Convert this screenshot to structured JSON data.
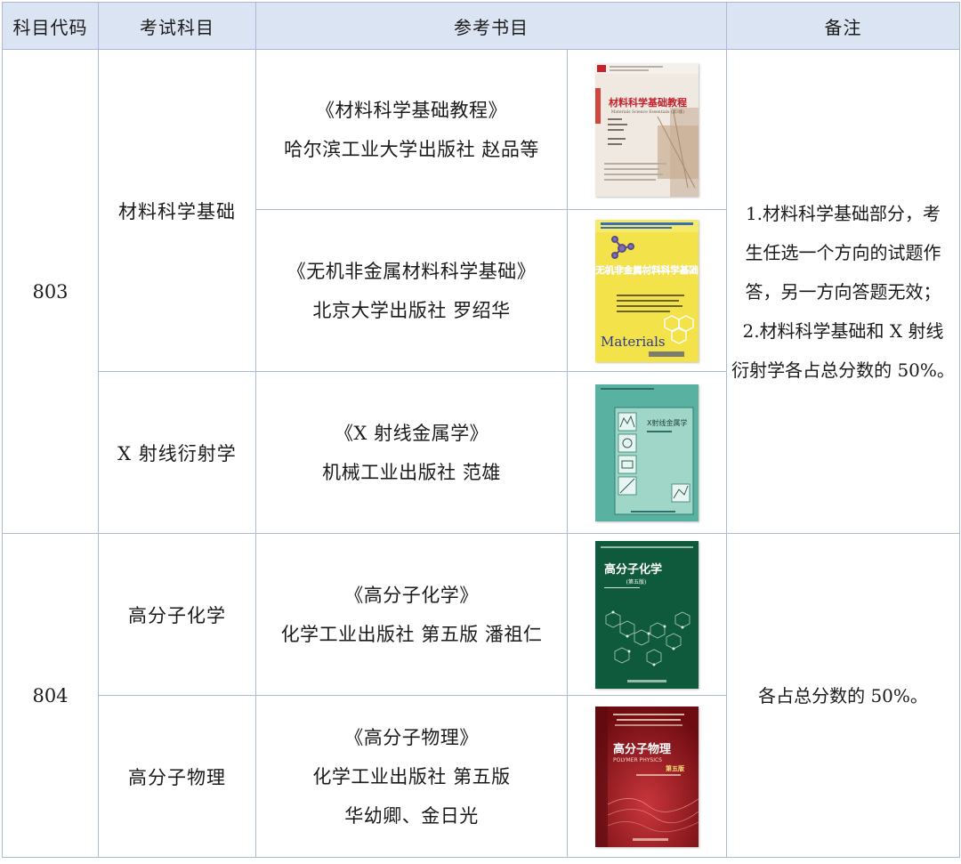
{
  "headers": {
    "code": "科目代码",
    "subject": "考试科目",
    "books": "参考书目",
    "notes": "备注"
  },
  "groups": [
    {
      "code": "803",
      "note_lines": [
        "1.材料科学基础部分，考",
        "生任选一个方向的试题作",
        "答，另一方向答题无效；",
        "2.材料科学基础和 X 射线",
        "衍射学各占总分数的 50%。"
      ],
      "subjects": [
        {
          "name": "材料科学基础",
          "books": [
            {
              "title": "《材料科学基础教程》",
              "publisher": "哈尔滨工业大学出版社 赵品等",
              "cover": {
                "title": "材料科学基础教程",
                "subtitle": "Materials Science Essentials (第3版)"
              }
            },
            {
              "title": "《无机非金属材料科学基础》",
              "publisher": "北京大学出版社 罗绍华",
              "cover": {
                "title": "无机非金属材料科学基础",
                "subtitle": "Materials"
              }
            }
          ]
        },
        {
          "name": "X 射线衍射学",
          "books": [
            {
              "title": "《X 射线金属学》",
              "publisher": "机械工业出版社 范雄",
              "cover": {
                "title": "X射线金属学",
                "subtitle": ""
              }
            }
          ]
        }
      ]
    },
    {
      "code": "804",
      "note_lines": [
        "各占总分数的 50%。"
      ],
      "subjects": [
        {
          "name": "高分子化学",
          "books": [
            {
              "title": "《高分子化学》",
              "publisher": "化学工业出版社 第五版 潘祖仁",
              "cover": {
                "title": "高分子化学",
                "subtitle": "(第五版)"
              }
            }
          ]
        },
        {
          "name": "高分子物理",
          "books": [
            {
              "title": "《高分子物理》",
              "publisher": "化学工业出版社 第五版",
              "authors": "华幼卿、金日光",
              "cover": {
                "title": "高分子物理",
                "subtitle": "POLYMER PHYSICS",
                "edition": "第五版"
              }
            }
          ]
        }
      ]
    }
  ],
  "colors": {
    "header_bg": "#dbe4f3",
    "border": "#aeb9d6",
    "cover1": "#e8ddd3",
    "cover2": "#f3e24a",
    "cover3": "#5fb8a6",
    "cover4": "#0f5a3c",
    "cover5": "#8a1118"
  }
}
